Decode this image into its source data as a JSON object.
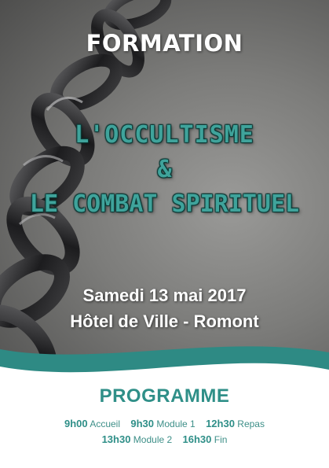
{
  "header": {
    "formation": "FORMATION"
  },
  "title": {
    "line1": "L'OCCULTISME",
    "line2": "&",
    "line3": "LE COMBAT SPIRITUEL"
  },
  "event": {
    "date": "Samedi 13 mai 2017",
    "place": "Hôtel de Ville - Romont"
  },
  "programme": {
    "heading": "PROGRAMME",
    "row1": [
      {
        "time": "9h00",
        "label": "Accueil"
      },
      {
        "time": "9h30",
        "label": "Module 1"
      },
      {
        "time": "12h30",
        "label": "Repas"
      }
    ],
    "row2": [
      {
        "time": "13h30",
        "label": "Module 2"
      },
      {
        "time": "16h30",
        "label": "Fin"
      }
    ]
  },
  "colors": {
    "accent": "#3fa39b",
    "accent_dark": "#2f8f88",
    "wave": "#2e8a84",
    "background_photo": "#7c7c7a"
  },
  "icons": [
    "chain-image"
  ]
}
